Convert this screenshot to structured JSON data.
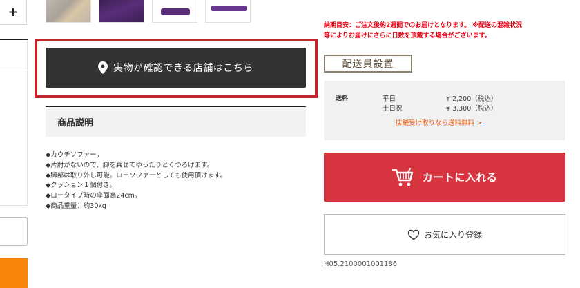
{
  "left_panel": {
    "plus_label": "+"
  },
  "thumbnails": [
    {
      "name": "thumb-1"
    },
    {
      "name": "thumb-2"
    },
    {
      "name": "thumb-3"
    },
    {
      "name": "thumb-4"
    }
  ],
  "store_button": {
    "icon": "map-pin-icon",
    "label": "実物が確認できる店舗はこちら"
  },
  "description": {
    "heading": "商品説明",
    "lines": [
      "◆カウチソファー。",
      "◆片肘がないので、脚を乗せてゆったりとくつろげます。",
      "◆脚部は取り外し可能。ローソファーとしても使用頂けます。",
      "◆クッション１個付き。",
      "◆ロータイプ時の座面高24cm。",
      "◆商品重量：約30kg"
    ]
  },
  "delivery": {
    "notice_line1": "納期目安：ご注文後約2週間でのお届けとなります。 ※配送の混雑状況",
    "notice_line2": "等によりお届けにさらに日数を頂戴する場合がございます。",
    "badge": "配送員設置"
  },
  "shipping": {
    "label": "送料",
    "rows": [
      {
        "day": "平日",
        "price": "¥ 2,200（税込）"
      },
      {
        "day": "土日祝",
        "price": "¥ 3,300（税込）"
      }
    ],
    "link": "店舗受け取りなら送料無料 >"
  },
  "cart": {
    "icon": "cart-icon",
    "label": "カートに入れる"
  },
  "favorite": {
    "icon": "heart-icon",
    "label": "お気に入り登録"
  },
  "sku": "H05.2100001001186",
  "colors": {
    "accent_red": "#d6343f",
    "notice_red": "#e50012",
    "link_orange": "#e85a0e",
    "dark_button": "#333333",
    "highlight_frame": "#c0272d",
    "side_orange": "#f7860b"
  }
}
